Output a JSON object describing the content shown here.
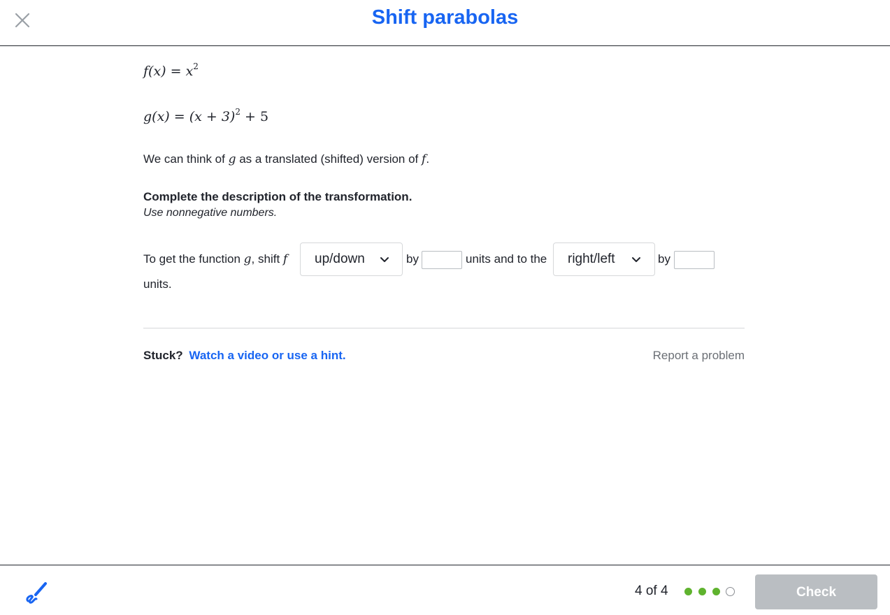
{
  "header": {
    "title": "Shift parabolas"
  },
  "problem": {
    "f_lhs": "f(x) = x",
    "f_exp": "2",
    "g_lhs": "g(x) = (x + 3)",
    "g_exp": "2",
    "g_rest": " + 5",
    "statement": {
      "pre": "We can think of ",
      "var_g": "g",
      "mid": " as a translated (shifted) version of ",
      "var_f": "f",
      "end": "."
    },
    "instruction": "Complete the description of the transformation.",
    "hint_note": "Use nonnegative numbers."
  },
  "question": {
    "prefix": "To get the function ",
    "var_g": "g",
    "comma": ", shift ",
    "var_f": "f",
    "dropdown1": "up/down",
    "by1": "by",
    "middle": "units and to the",
    "dropdown2": "right/left",
    "by2": "by",
    "suffix": "units.",
    "input1_value": "",
    "input2_value": ""
  },
  "help": {
    "stuck": "Stuck?",
    "link": "Watch a video or use a hint.",
    "report": "Report a problem"
  },
  "footer": {
    "progress": "4 of 4",
    "completed_dots": 3,
    "total_dots": 4,
    "check_label": "Check"
  },
  "colors": {
    "accent": "#1865f2",
    "progress_done": "#5fb32e",
    "disabled_button": "#babec2"
  },
  "icons": {
    "close": "close-icon",
    "chevron": "chevron-down-icon",
    "scratchpad": "pencil-icon"
  }
}
